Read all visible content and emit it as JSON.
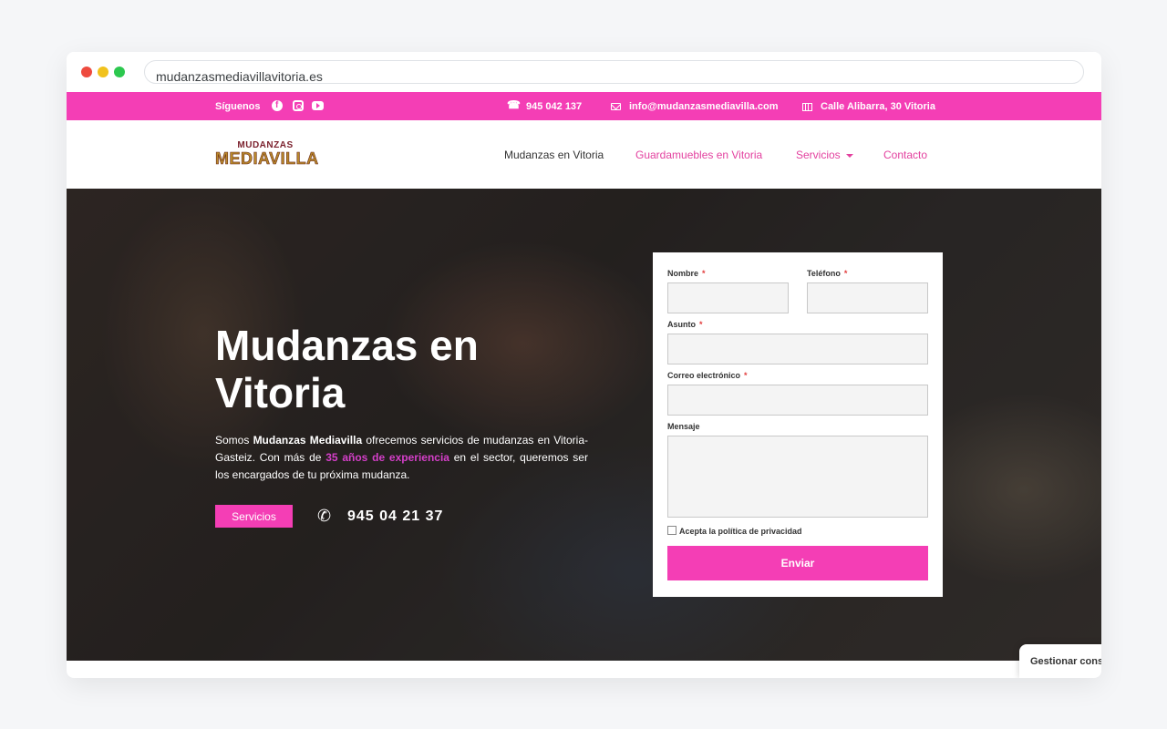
{
  "browser": {
    "url": "mudanzasmediavillavitoria.es"
  },
  "topbar": {
    "follow_label": "Síguenos",
    "phone": "945 042 137",
    "email": "info@mudanzasmediavilla.com",
    "address": "Calle Alibarra, 30 Vitoria"
  },
  "header": {
    "logo_top": "MUDANZAS",
    "logo_bottom": "MEDIAVILLA",
    "nav": [
      {
        "label": "Mudanzas en Vitoria"
      },
      {
        "label": "Guardamuebles en Vitoria"
      },
      {
        "label": "Servicios"
      },
      {
        "label": "Contacto"
      }
    ]
  },
  "hero": {
    "title": "Mudanzas en Vitoria",
    "desc_1": "Somos ",
    "desc_bold": "Mudanzas Mediavilla",
    "desc_2": " ofrecemos servicios de mudanzas en Vitoria-Gasteiz. Con más de ",
    "desc_highlight": "35 años de experiencia",
    "desc_3": " en el sector, queremos ser los encargados de tu próxima mudanza.",
    "button_label": "Servicios",
    "phone": "945 04 21 37"
  },
  "form": {
    "name_label": "Nombre",
    "phone_label": "Teléfono",
    "subject_label": "Asunto",
    "email_label": "Correo electrónico",
    "message_label": "Mensaje",
    "required_mark": "*",
    "privacy_label": "Acepta la política de privacidad",
    "submit_label": "Enviar"
  },
  "cookie": {
    "label": "Gestionar consentimiento"
  },
  "colors": {
    "accent": "#f43eb5",
    "nav_pink": "#e3419f",
    "highlight": "#d43fc8"
  }
}
